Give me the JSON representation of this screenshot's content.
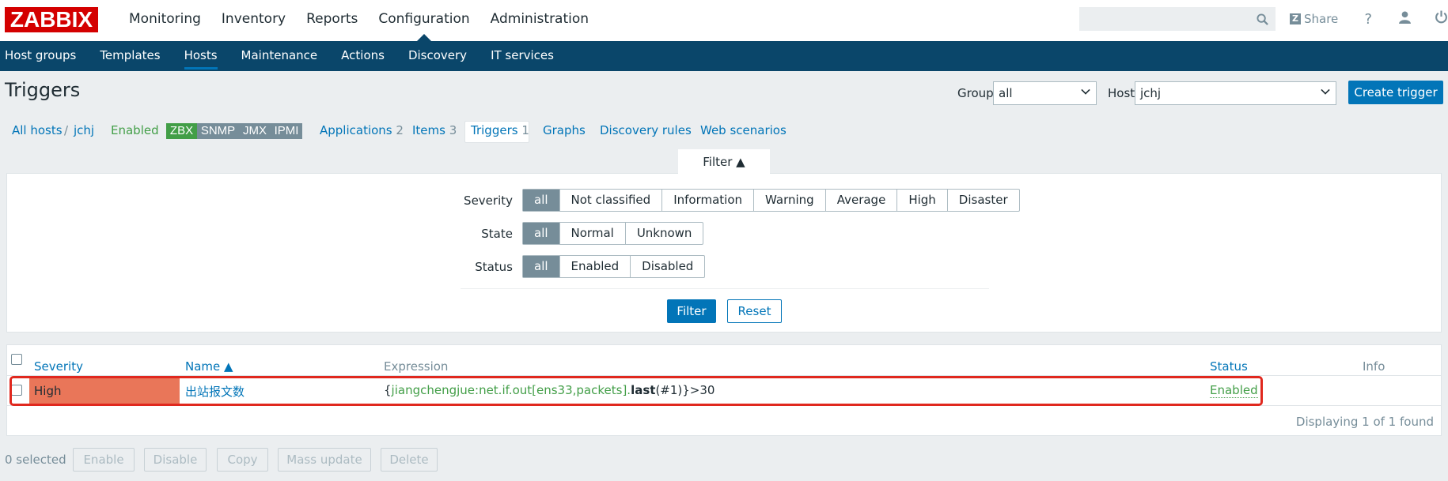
{
  "brand": {
    "logo_text": "ZABBIX",
    "logo_color": "#d40000"
  },
  "top_menu": [
    "Monitoring",
    "Inventory",
    "Reports",
    "Configuration",
    "Administration"
  ],
  "top_right": {
    "share_label": "Share",
    "help_glyph": "?",
    "search_placeholder": ""
  },
  "sub_menu": [
    "Host groups",
    "Templates",
    "Hosts",
    "Maintenance",
    "Actions",
    "Discovery",
    "IT services"
  ],
  "page": {
    "title": "Triggers",
    "group_label": "Group",
    "group_value": "all",
    "host_label": "Host",
    "host_value": "jchj",
    "create_button": "Create trigger"
  },
  "breadcrumb": {
    "all_hosts": "All hosts",
    "sep": "/",
    "host": "jchj",
    "status": "Enabled",
    "tags": [
      "ZBX",
      "SNMP",
      "JMX",
      "IPMI"
    ],
    "applications": "Applications",
    "applications_count": "2",
    "items": "Items",
    "items_count": "3",
    "triggers": "Triggers",
    "triggers_count": "1",
    "graphs": "Graphs",
    "discovery_rules": "Discovery rules",
    "web_scenarios": "Web scenarios"
  },
  "filter": {
    "tab_label": "Filter ▲",
    "severity_label": "Severity",
    "severity_options": [
      "all",
      "Not classified",
      "Information",
      "Warning",
      "Average",
      "High",
      "Disaster"
    ],
    "state_label": "State",
    "state_options": [
      "all",
      "Normal",
      "Unknown"
    ],
    "status_label": "Status",
    "status_options": [
      "all",
      "Enabled",
      "Disabled"
    ],
    "apply_button": "Filter",
    "reset_button": "Reset"
  },
  "table": {
    "columns": {
      "severity": "Severity",
      "name": "Name ▲",
      "expression": "Expression",
      "status": "Status",
      "info": "Info"
    },
    "rows": [
      {
        "severity": "High",
        "name": "出站报文数",
        "expr_open": "{",
        "expr_item": "jiangchengjue:net.if.out[ens33,packets].",
        "expr_func": "last",
        "expr_args": "(#1)",
        "expr_close": "}>30",
        "status": "Enabled"
      }
    ],
    "footer": "Displaying 1 of 1 found"
  },
  "actions": {
    "selected": "0 selected",
    "buttons": [
      "Enable",
      "Disable",
      "Copy",
      "Mass update",
      "Delete"
    ]
  },
  "colors": {
    "accent": "#0275b8",
    "nav": "#0a466a",
    "severity_high": "#e97659",
    "enabled": "#429e47",
    "highlight_box": "#e0281e"
  }
}
